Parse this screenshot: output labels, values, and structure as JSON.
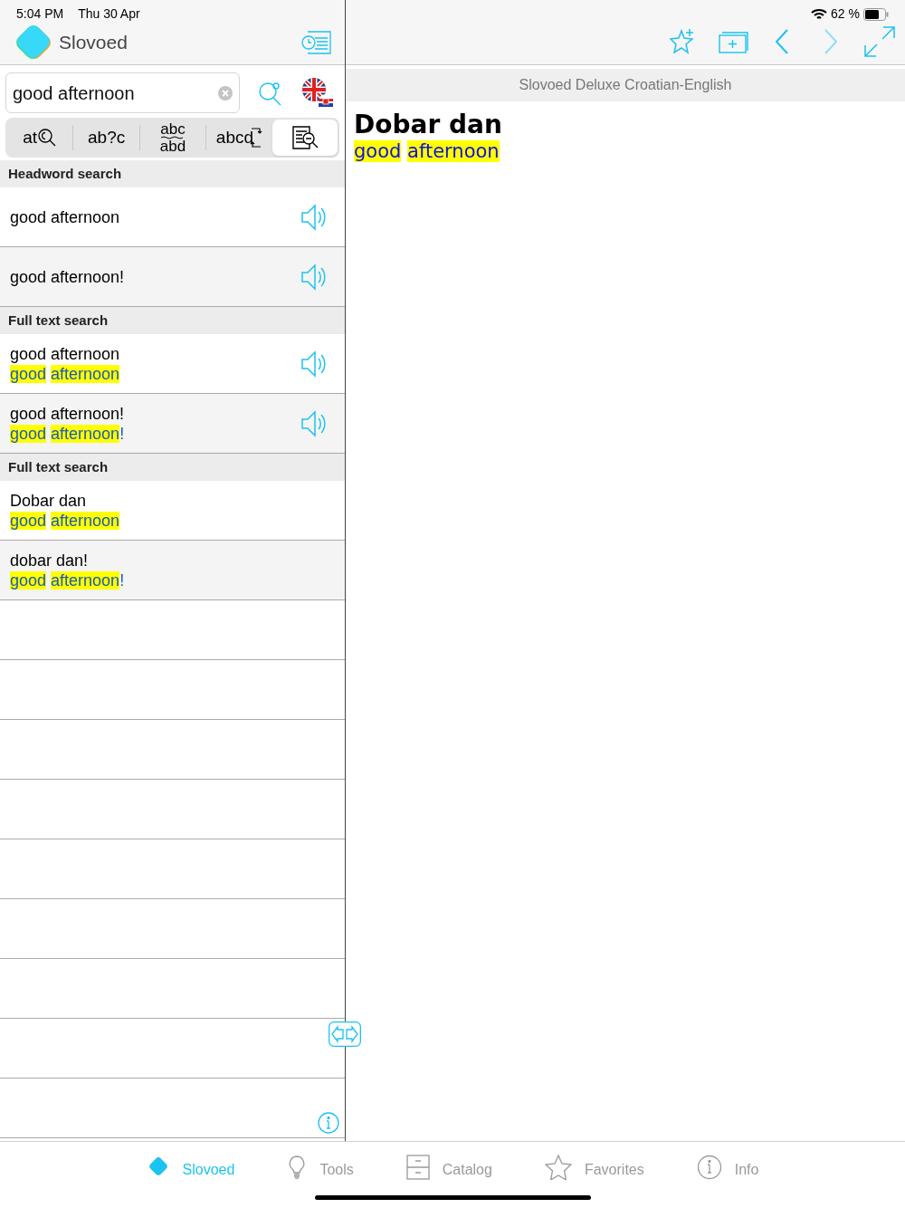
{
  "status_bar": {
    "time": "5:04 PM",
    "date": "Thu 30 Apr",
    "battery": "62 %"
  },
  "app": {
    "name": "Slovoed"
  },
  "search": {
    "value": "good afternoon"
  },
  "modes": [
    {
      "kind": "wildcard-c",
      "label": "at",
      "selected": false
    },
    {
      "kind": "plain",
      "label": "ab?c",
      "selected": false
    },
    {
      "kind": "stacked",
      "label": "abc",
      "label2": "abd",
      "selected": false
    },
    {
      "kind": "swap",
      "label": "abcd",
      "selected": false
    },
    {
      "kind": "fulltext",
      "selected": true
    }
  ],
  "sections": [
    {
      "title": "Headword search",
      "rows": [
        {
          "headword": "good afternoon",
          "sound": true
        },
        {
          "headword": "good afternoon!",
          "sound": true
        }
      ]
    },
    {
      "title": "Full text search",
      "rows": [
        {
          "headword": "good afternoon",
          "sound": true,
          "translation": {
            "words": [
              {
                "text": "good",
                "highlight": true
              },
              {
                "text": "afternoon",
                "highlight": true
              }
            ]
          }
        },
        {
          "headword": "good afternoon!",
          "sound": true,
          "translation": {
            "words": [
              {
                "text": "good",
                "highlight": true
              },
              {
                "text": "afternoon",
                "highlight": true
              }
            ],
            "suffix": "!"
          }
        }
      ]
    },
    {
      "title": "Full text search",
      "rows": [
        {
          "headword": "Dobar dan",
          "sound": false,
          "translation": {
            "words": [
              {
                "text": "good",
                "highlight": true
              },
              {
                "text": "afternoon",
                "highlight": true
              }
            ]
          }
        },
        {
          "headword": "dobar dan!",
          "sound": false,
          "translation": {
            "words": [
              {
                "text": "good",
                "highlight": true
              },
              {
                "text": "afternoon",
                "highlight": true
              }
            ],
            "suffix": "!"
          }
        }
      ]
    }
  ],
  "article": {
    "dictionary": "Slovoed Deluxe Croatian-English",
    "headword": "Dobar dan",
    "translation": {
      "words": [
        {
          "text": "good",
          "highlight": true
        },
        {
          "text": "afternoon",
          "highlight": true
        }
      ]
    }
  },
  "tab_bar": [
    {
      "kind": "slovoed",
      "label": "Slovoed",
      "selected": true
    },
    {
      "kind": "tools",
      "label": "Tools",
      "selected": false
    },
    {
      "kind": "catalog",
      "label": "Catalog",
      "selected": false
    },
    {
      "kind": "favorites",
      "label": "Favorites",
      "selected": false
    },
    {
      "kind": "info",
      "label": "Info",
      "selected": false
    }
  ]
}
